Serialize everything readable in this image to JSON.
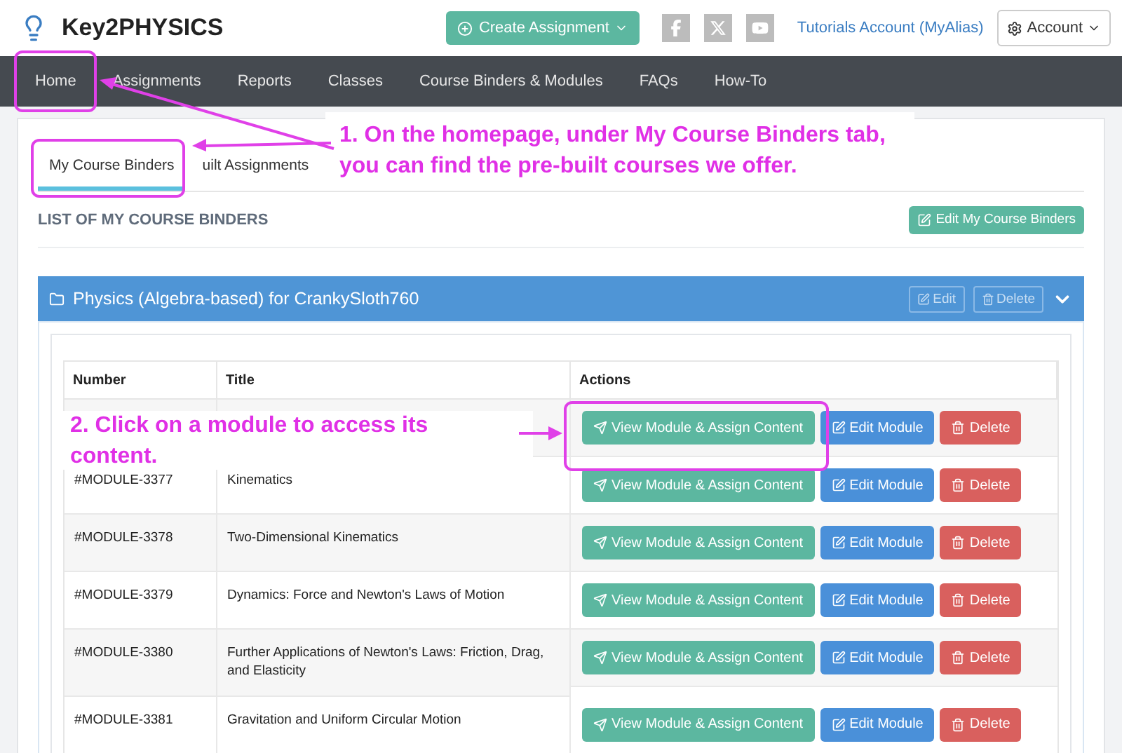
{
  "header": {
    "logo": "Key2PHYSICS",
    "create_button": "Create Assignment",
    "account_link": "Tutorials Account (MyAlias)",
    "account_menu": "Account"
  },
  "nav": [
    "Home",
    "Assignments",
    "Reports",
    "Classes",
    "Course Binders & Modules",
    "FAQs",
    "How-To"
  ],
  "tabs": [
    {
      "label": "My Course Binders",
      "selected": true
    },
    {
      "label": "uilt Assignments",
      "selected": false
    }
  ],
  "section": {
    "title": "LIST OF MY COURSE BINDERS",
    "edit_button": "Edit My Course Binders"
  },
  "binder": {
    "title": "Physics (Algebra-based) for CrankySloth760",
    "edit": "Edit",
    "delete": "Delete",
    "expanded": true
  },
  "table": {
    "columns": [
      "Number",
      "Title",
      "Actions"
    ],
    "rows": [
      {
        "view": "View Module & Assign Content",
        "edit": "Edit Module",
        "delete": "Delete"
      },
      {
        "number": "#MODULE-3377",
        "title": "Kinematics",
        "view": "View Module & Assign Content",
        "edit": "Edit Module",
        "delete": "Delete"
      },
      {
        "number": "#MODULE-3378",
        "title": "Two-Dimensional Kinematics",
        "view": "View Module & Assign Content",
        "edit": "Edit Module",
        "delete": "Delete"
      },
      {
        "number": "#MODULE-3379",
        "title": "Dynamics: Force and Newton's Laws of Motion",
        "view": "View Module & Assign Content",
        "edit": "Edit Module",
        "delete": "Delete"
      },
      {
        "number": "#MODULE-3380",
        "title": "Further Applications of Newton's Laws: Friction, Drag, and Elasticity",
        "view": "View Module & Assign Content",
        "edit": "Edit Module",
        "delete": "Delete"
      },
      {
        "number": "#MODULE-3381",
        "title": "Gravitation and Uniform Circular Motion",
        "view": "View Module & Assign Content",
        "edit": "Edit Module",
        "delete": "Delete"
      }
    ]
  },
  "annotations": [
    "1. On the homepage, under My Course Binders tab, you can find the pre-built courses we offer.",
    "2. Click on a module to access its content."
  ]
}
